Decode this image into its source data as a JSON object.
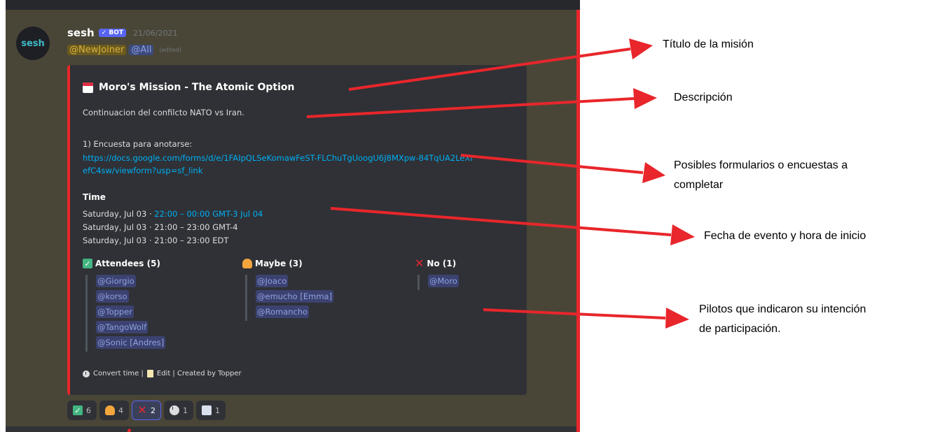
{
  "message": {
    "avatar_text": "sesh",
    "username": "sesh",
    "bot_badge": "✓ BOT",
    "timestamp": "21/06/2021",
    "mentions": [
      "@NewJoiner",
      "@All"
    ],
    "edited": "(edited)"
  },
  "embed": {
    "title": "Moro's Mission - The Atomic Option",
    "description": "Continuacion del confilcto NATO vs Iran.",
    "poll_label": "1) Encuesta para anotarse:",
    "link": "https://docs.google.com/forms/d/e/1FAIpQLSeKomawFeST-FLChuTgUoogU6J8MXpw-84TqUA2LeXIefC4sw/viewform?usp=sf_link",
    "time_heading": "Time",
    "time_lines": {
      "l1_prefix": "Saturday, Jul 03 · ",
      "l1_link": "22:00 – 00:00 GMT-3 Jul 04",
      "l2": "Saturday, Jul 03 · 21:00 – 23:00 GMT-4",
      "l3": "Saturday, Jul 03 · 21:00 – 23:00 EDT"
    },
    "attendees": {
      "header": "Attendees (5)",
      "names": [
        "@Giorgio",
        "@korso",
        "@Topper",
        "@TangoWolf",
        "@Sonic [Andres]"
      ]
    },
    "maybe": {
      "header": "Maybe (3)",
      "names": [
        "@Joaco",
        "@emucho [Emma]",
        "@Romancho"
      ]
    },
    "no": {
      "header": "No (1)",
      "names": [
        "@Moro"
      ]
    },
    "footer": {
      "convert": "Convert time |",
      "edit": "Edit | Created by Topper"
    }
  },
  "reactions": [
    {
      "icon": "check",
      "count": "6"
    },
    {
      "icon": "person",
      "count": "4"
    },
    {
      "icon": "cross",
      "count": "2",
      "selected": true
    },
    {
      "icon": "clock",
      "count": "1"
    },
    {
      "icon": "memo",
      "count": "1"
    }
  ],
  "annotations": {
    "titulo": "Título de la misión",
    "descripcion": "Descripción",
    "formularios_1": "Posibles formularios o encuestas a",
    "formularios_2": "completar",
    "fecha": "Fecha de evento y hora de inicio",
    "pilotos_1": "Pilotos que indicaron su intención",
    "pilotos_2": "de participación."
  },
  "colors": {
    "arrow": "#e8262b",
    "accent": "#e8262b",
    "link": "#00aff4",
    "mention": "#8ea1e1"
  }
}
